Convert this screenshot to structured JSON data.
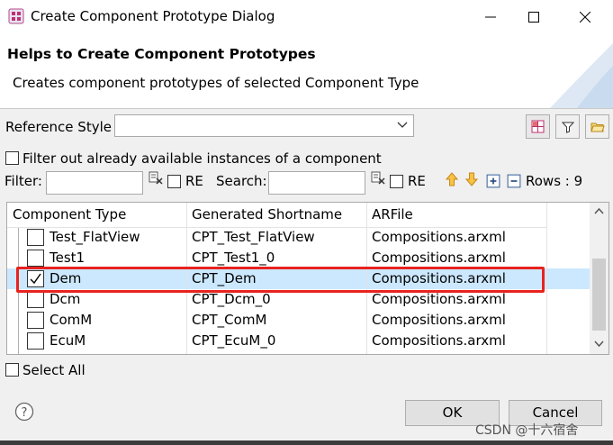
{
  "window": {
    "title": "Create Component Prototype Dialog",
    "icon": "app-icon"
  },
  "header": {
    "title": "Helps to Create Component Prototypes",
    "description": "Creates component prototypes of selected Component Type"
  },
  "reference_style": {
    "label": "Reference Style",
    "value": ""
  },
  "filter_checkbox": {
    "label": "Filter out already available instances of a component",
    "checked": false
  },
  "filter": {
    "label": "Filter:",
    "value": "",
    "re_label": "RE"
  },
  "search": {
    "label": "Search:",
    "value": "",
    "re_label": "RE"
  },
  "rows_label": "Rows : 9",
  "table": {
    "columns": [
      "Component Type",
      "Generated Shortname",
      "ARFile"
    ],
    "rows": [
      {
        "type": "Test_FlatView",
        "shortname": "CPT_Test_FlatView",
        "file": "Compositions.arxml",
        "checked": false,
        "selected": false
      },
      {
        "type": "Test1",
        "shortname": "CPT_Test1_0",
        "file": "Compositions.arxml",
        "checked": false,
        "selected": false
      },
      {
        "type": "Dem",
        "shortname": "CPT_Dem",
        "file": "Compositions.arxml",
        "checked": true,
        "selected": true
      },
      {
        "type": "Dcm",
        "shortname": "CPT_Dcm_0",
        "file": "Compositions.arxml",
        "checked": false,
        "selected": false
      },
      {
        "type": "ComM",
        "shortname": "CPT_ComM",
        "file": "Compositions.arxml",
        "checked": false,
        "selected": false
      },
      {
        "type": "EcuM",
        "shortname": "CPT_EcuM_0",
        "file": "Compositions.arxml",
        "checked": false,
        "selected": false
      }
    ]
  },
  "select_all": {
    "label": "Select All",
    "checked": false
  },
  "buttons": {
    "ok": "OK",
    "cancel": "Cancel"
  },
  "watermark": "CSDN @十六宿舍",
  "colors": {
    "selection": "#cce8ff",
    "highlight_box": "#e8231f",
    "arrow_icons": "#e8a21a"
  }
}
